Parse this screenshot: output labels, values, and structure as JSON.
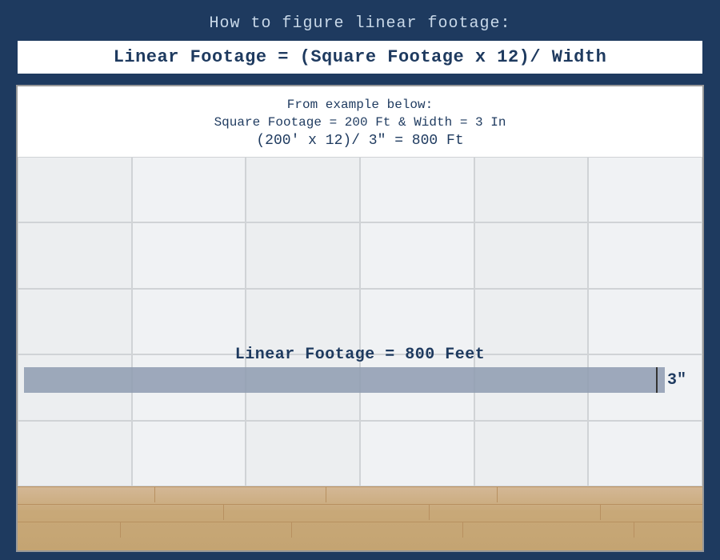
{
  "header": {
    "title": "How to figure linear footage:"
  },
  "formula": {
    "text": "Linear Footage = (Square Footage x 12)/ Width"
  },
  "example": {
    "label": "From example below:",
    "values": "Square Footage = 200 Ft & Width = 3 In",
    "calculation": "(200′  x 12)/  3″ = 800 Ft"
  },
  "diagram": {
    "linear_label": "Linear Footage = 800 Feet",
    "width_label": "3″"
  }
}
